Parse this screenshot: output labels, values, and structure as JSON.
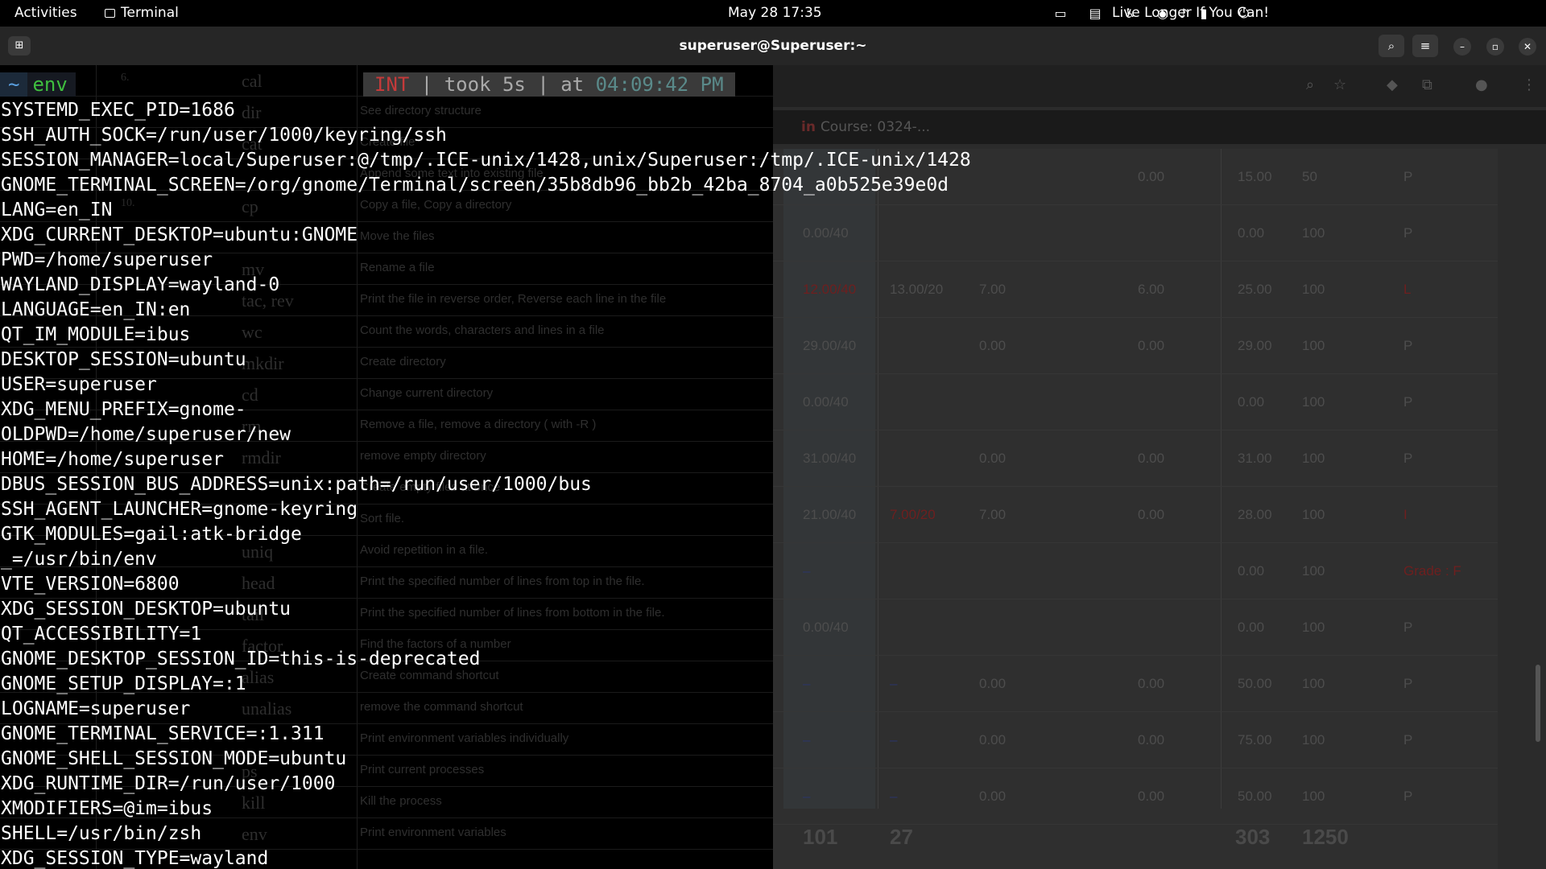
{
  "topbar": {
    "activities": "Activities",
    "app_name": "Terminal",
    "datetime": "May 28  17:35",
    "motto": "Live Longer If You Can!",
    "tray_icons": [
      "screen-share-icon",
      "clipboard-icon",
      "accessibility-icon",
      "wifi-icon",
      "volume-icon",
      "battery-icon",
      "power-icon"
    ]
  },
  "terminal": {
    "title": "superuser@Superuser:~",
    "prompt": {
      "dir": "~",
      "command": "env"
    },
    "status": {
      "signal": "INT",
      "took_label": "took",
      "took_value": "5s",
      "at_label": "at",
      "time": "04:09:42 PM"
    },
    "lines": [
      "SYSTEMD_EXEC_PID=1686",
      "SSH_AUTH_SOCK=/run/user/1000/keyring/ssh",
      "SESSION_MANAGER=local/Superuser:@/tmp/.ICE-unix/1428,unix/Superuser:/tmp/.ICE-unix/1428",
      "GNOME_TERMINAL_SCREEN=/org/gnome/Terminal/screen/35b8db96_bb2b_42ba_8704_a0b525e39e0d",
      "LANG=en_IN",
      "XDG_CURRENT_DESKTOP=ubuntu:GNOME",
      "PWD=/home/superuser",
      "WAYLAND_DISPLAY=wayland-0",
      "LANGUAGE=en_IN:en",
      "QT_IM_MODULE=ibus",
      "DESKTOP_SESSION=ubuntu",
      "USER=superuser",
      "XDG_MENU_PREFIX=gnome-",
      "OLDPWD=/home/superuser/new",
      "HOME=/home/superuser",
      "DBUS_SESSION_BUS_ADDRESS=unix:path=/run/user/1000/bus",
      "SSH_AGENT_LAUNCHER=gnome-keyring",
      "GTK_MODULES=gail:atk-bridge",
      "_=/usr/bin/env",
      "VTE_VERSION=6800",
      "XDG_SESSION_DESKTOP=ubuntu",
      "QT_ACCESSIBILITY=1",
      "GNOME_DESKTOP_SESSION_ID=this-is-deprecated",
      "GNOME_SETUP_DISPLAY=:1",
      "LOGNAME=superuser",
      "GNOME_TERMINAL_SERVICE=:1.311",
      "GNOME_SHELL_SESSION_MODE=ubuntu",
      "XDG_RUNTIME_DIR=/run/user/1000",
      "XMODIFIERS=@im=ibus",
      "SHELL=/usr/bin/zsh",
      "XDG_SESSION_TYPE=wayland"
    ]
  },
  "background_doc": {
    "rows": [
      {
        "num": "6.",
        "cmd": "cal",
        "desc": ""
      },
      {
        "num": "",
        "cmd": "dir",
        "desc": "See directory structure"
      },
      {
        "num": "",
        "cmd": "cat",
        "desc": "Create file"
      },
      {
        "num": "",
        "cmd": "",
        "desc": "Append some text into existing file"
      },
      {
        "num": "10.",
        "cmd": "cp",
        "desc": "Copy a file, Copy a directory"
      },
      {
        "num": "",
        "cmd": "",
        "desc": "Move the files"
      },
      {
        "num": "",
        "cmd": "mv",
        "desc": "Rename a file"
      },
      {
        "num": "",
        "cmd": "tac, rev",
        "desc": "Print the file in reverse order, Reverse each line in the file"
      },
      {
        "num": "",
        "cmd": "wc",
        "desc": "Count the words, characters and lines in a file"
      },
      {
        "num": "",
        "cmd": "mkdir",
        "desc": "Create directory"
      },
      {
        "num": "",
        "cmd": "cd",
        "desc": "Change current directory"
      },
      {
        "num": "",
        "cmd": "rm",
        "desc": "Remove a file, remove a directory ( with -R )"
      },
      {
        "num": "",
        "cmd": "rmdir",
        "desc": "remove empty directory"
      },
      {
        "num": "",
        "cmd": "",
        "desc": "Create empty files at once"
      },
      {
        "num": "",
        "cmd": "",
        "desc": "Sort file."
      },
      {
        "num": "",
        "cmd": "uniq",
        "desc": "Avoid repetition in a file."
      },
      {
        "num": "",
        "cmd": "head",
        "desc": "Print the specified number of lines from top in the file."
      },
      {
        "num": "",
        "cmd": "tail",
        "desc": "Print the specified number of lines from bottom in the file."
      },
      {
        "num": "",
        "cmd": "factor",
        "desc": "Find the factors of a number"
      },
      {
        "num": "",
        "cmd": "alias",
        "desc": "Create command shortcut"
      },
      {
        "num": "",
        "cmd": "unalias",
        "desc": "remove the command shortcut"
      },
      {
        "num": "",
        "cmd": "",
        "desc": "Print environment variables individually"
      },
      {
        "num": "",
        "cmd": "ps",
        "desc": "Print current processes"
      },
      {
        "num": "",
        "cmd": "kill",
        "desc": "Kill the process"
      },
      {
        "num": "",
        "cmd": "env",
        "desc": "Print environment variables"
      }
    ]
  },
  "browser": {
    "tab_title": "Course: 0324-...",
    "rows": [
      {
        "c1": "",
        "c2": "",
        "c3": "",
        "c4": "0.00",
        "c5": "15.00",
        "c6": "50",
        "c7": "P",
        "c1_style": "",
        "c2_style": "",
        "c7_style": ""
      },
      {
        "c1": "0.00/40",
        "c2": "",
        "c3": "",
        "c4": "",
        "c5": "0.00",
        "c6": "100",
        "c7": "P",
        "c1_style": "",
        "c2_style": "",
        "c7_style": ""
      },
      {
        "c1": "12.00/40",
        "c2": "13.00/20",
        "c3": "7.00",
        "c4": "6.00",
        "c5": "25.00",
        "c6": "100",
        "c7": "L",
        "c1_style": "red",
        "c2_style": "",
        "c7_style": "red"
      },
      {
        "c1": "29.00/40",
        "c2": "",
        "c3": "0.00",
        "c4": "0.00",
        "c5": "29.00",
        "c6": "100",
        "c7": "P",
        "c1_style": "",
        "c2_style": "",
        "c7_style": ""
      },
      {
        "c1": "0.00/40",
        "c2": "",
        "c3": "",
        "c4": "",
        "c5": "0.00",
        "c6": "100",
        "c7": "P",
        "c1_style": "",
        "c2_style": "",
        "c7_style": ""
      },
      {
        "c1": "31.00/40",
        "c2": "",
        "c3": "0.00",
        "c4": "0.00",
        "c5": "31.00",
        "c6": "100",
        "c7": "P",
        "c1_style": "",
        "c2_style": "",
        "c7_style": ""
      },
      {
        "c1": "21.00/40",
        "c2": "7.00/20",
        "c3": "7.00",
        "c4": "0.00",
        "c5": "28.00",
        "c6": "100",
        "c7": "I",
        "c1_style": "",
        "c2_style": "red",
        "c7_style": "red"
      },
      {
        "c1": "–",
        "c2": "",
        "c3": "",
        "c4": "",
        "c5": "0.00",
        "c6": "100",
        "c7": "Grade : F",
        "c1_style": "blue",
        "c2_style": "",
        "c7_style": "red"
      },
      {
        "c1": "0.00/40",
        "c2": "",
        "c3": "",
        "c4": "",
        "c5": "0.00",
        "c6": "100",
        "c7": "P",
        "c1_style": "",
        "c2_style": "",
        "c7_style": ""
      },
      {
        "c1": "–",
        "c2": "–",
        "c3": "0.00",
        "c4": "0.00",
        "c5": "50.00",
        "c6": "100",
        "c7": "P",
        "c1_style": "blue",
        "c2_style": "blue",
        "c7_style": ""
      },
      {
        "c1": "–",
        "c2": "–",
        "c3": "0.00",
        "c4": "0.00",
        "c5": "75.00",
        "c6": "100",
        "c7": "P",
        "c1_style": "blue",
        "c2_style": "blue",
        "c7_style": ""
      },
      {
        "c1": "–",
        "c2": "–",
        "c3": "0.00",
        "c4": "0.00",
        "c5": "50.00",
        "c6": "100",
        "c7": "P",
        "c1_style": "blue",
        "c2_style": "blue",
        "c7_style": ""
      }
    ],
    "totals": {
      "t1": "101",
      "t2": "27",
      "t5": "303",
      "t6": "1250"
    }
  }
}
